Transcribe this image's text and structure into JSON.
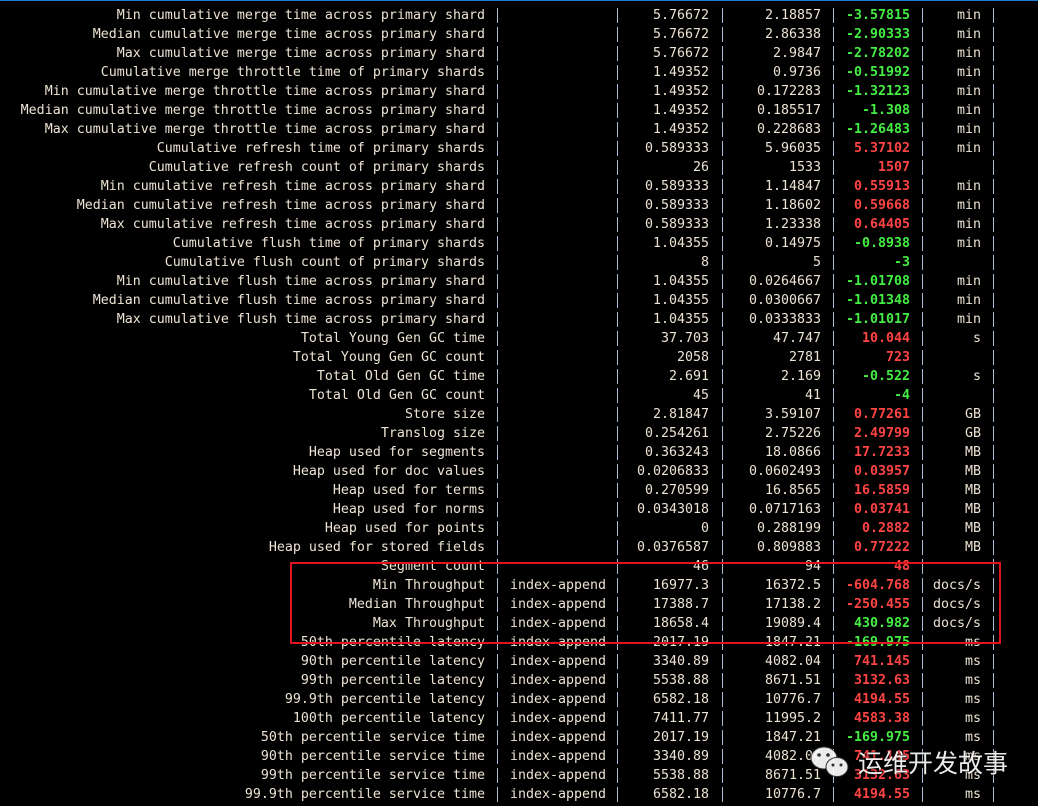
{
  "colors": {
    "positive_better": "#44ee44",
    "negative_worse": "#ff4444",
    "text": "#ede3d3",
    "pipe": "#a9bdd6",
    "highlight_box": "#e0141e"
  },
  "watermark": {
    "text": "运维开发故事",
    "icon": "wechat-icon"
  },
  "rows": [
    {
      "metric": "Min cumulative merge time across primary shard",
      "task": "",
      "baseline": "5.76672",
      "contender": "2.18857",
      "diff": "-3.57815",
      "unit": "min",
      "diff_color": "green"
    },
    {
      "metric": "Median cumulative merge time across primary shard",
      "task": "",
      "baseline": "5.76672",
      "contender": "2.86338",
      "diff": "-2.90333",
      "unit": "min",
      "diff_color": "green"
    },
    {
      "metric": "Max cumulative merge time across primary shard",
      "task": "",
      "baseline": "5.76672",
      "contender": "2.9847",
      "diff": "-2.78202",
      "unit": "min",
      "diff_color": "green"
    },
    {
      "metric": "Cumulative merge throttle time of primary shards",
      "task": "",
      "baseline": "1.49352",
      "contender": "0.9736",
      "diff": "-0.51992",
      "unit": "min",
      "diff_color": "green"
    },
    {
      "metric": "Min cumulative merge throttle time across primary shard",
      "task": "",
      "baseline": "1.49352",
      "contender": "0.172283",
      "diff": "-1.32123",
      "unit": "min",
      "diff_color": "green"
    },
    {
      "metric": "Median cumulative merge throttle time across primary shard",
      "task": "",
      "baseline": "1.49352",
      "contender": "0.185517",
      "diff": "-1.308",
      "unit": "min",
      "diff_color": "green"
    },
    {
      "metric": "Max cumulative merge throttle time across primary shard",
      "task": "",
      "baseline": "1.49352",
      "contender": "0.228683",
      "diff": "-1.26483",
      "unit": "min",
      "diff_color": "green"
    },
    {
      "metric": "Cumulative refresh time of primary shards",
      "task": "",
      "baseline": "0.589333",
      "contender": "5.96035",
      "diff": "5.37102",
      "unit": "min",
      "diff_color": "red"
    },
    {
      "metric": "Cumulative refresh count of primary shards",
      "task": "",
      "baseline": "26",
      "contender": "1533",
      "diff": "1507",
      "unit": "",
      "diff_color": "red"
    },
    {
      "metric": "Min cumulative refresh time across primary shard",
      "task": "",
      "baseline": "0.589333",
      "contender": "1.14847",
      "diff": "0.55913",
      "unit": "min",
      "diff_color": "red"
    },
    {
      "metric": "Median cumulative refresh time across primary shard",
      "task": "",
      "baseline": "0.589333",
      "contender": "1.18602",
      "diff": "0.59668",
      "unit": "min",
      "diff_color": "red"
    },
    {
      "metric": "Max cumulative refresh time across primary shard",
      "task": "",
      "baseline": "0.589333",
      "contender": "1.23338",
      "diff": "0.64405",
      "unit": "min",
      "diff_color": "red"
    },
    {
      "metric": "Cumulative flush time of primary shards",
      "task": "",
      "baseline": "1.04355",
      "contender": "0.14975",
      "diff": "-0.8938",
      "unit": "min",
      "diff_color": "green"
    },
    {
      "metric": "Cumulative flush count of primary shards",
      "task": "",
      "baseline": "8",
      "contender": "5",
      "diff": "-3",
      "unit": "",
      "diff_color": "green"
    },
    {
      "metric": "Min cumulative flush time across primary shard",
      "task": "",
      "baseline": "1.04355",
      "contender": "0.0264667",
      "diff": "-1.01708",
      "unit": "min",
      "diff_color": "green"
    },
    {
      "metric": "Median cumulative flush time across primary shard",
      "task": "",
      "baseline": "1.04355",
      "contender": "0.0300667",
      "diff": "-1.01348",
      "unit": "min",
      "diff_color": "green"
    },
    {
      "metric": "Max cumulative flush time across primary shard",
      "task": "",
      "baseline": "1.04355",
      "contender": "0.0333833",
      "diff": "-1.01017",
      "unit": "min",
      "diff_color": "green"
    },
    {
      "metric": "Total Young Gen GC time",
      "task": "",
      "baseline": "37.703",
      "contender": "47.747",
      "diff": "10.044",
      "unit": "s",
      "diff_color": "red"
    },
    {
      "metric": "Total Young Gen GC count",
      "task": "",
      "baseline": "2058",
      "contender": "2781",
      "diff": "723",
      "unit": "",
      "diff_color": "red"
    },
    {
      "metric": "Total Old Gen GC time",
      "task": "",
      "baseline": "2.691",
      "contender": "2.169",
      "diff": "-0.522",
      "unit": "s",
      "diff_color": "green"
    },
    {
      "metric": "Total Old Gen GC count",
      "task": "",
      "baseline": "45",
      "contender": "41",
      "diff": "-4",
      "unit": "",
      "diff_color": "green"
    },
    {
      "metric": "Store size",
      "task": "",
      "baseline": "2.81847",
      "contender": "3.59107",
      "diff": "0.77261",
      "unit": "GB",
      "diff_color": "red"
    },
    {
      "metric": "Translog size",
      "task": "",
      "baseline": "0.254261",
      "contender": "2.75226",
      "diff": "2.49799",
      "unit": "GB",
      "diff_color": "red"
    },
    {
      "metric": "Heap used for segments",
      "task": "",
      "baseline": "0.363243",
      "contender": "18.0866",
      "diff": "17.7233",
      "unit": "MB",
      "diff_color": "red"
    },
    {
      "metric": "Heap used for doc values",
      "task": "",
      "baseline": "0.0206833",
      "contender": "0.0602493",
      "diff": "0.03957",
      "unit": "MB",
      "diff_color": "red"
    },
    {
      "metric": "Heap used for terms",
      "task": "",
      "baseline": "0.270599",
      "contender": "16.8565",
      "diff": "16.5859",
      "unit": "MB",
      "diff_color": "red"
    },
    {
      "metric": "Heap used for norms",
      "task": "",
      "baseline": "0.0343018",
      "contender": "0.0717163",
      "diff": "0.03741",
      "unit": "MB",
      "diff_color": "red"
    },
    {
      "metric": "Heap used for points",
      "task": "",
      "baseline": "0",
      "contender": "0.288199",
      "diff": "0.2882",
      "unit": "MB",
      "diff_color": "red"
    },
    {
      "metric": "Heap used for stored fields",
      "task": "",
      "baseline": "0.0376587",
      "contender": "0.809883",
      "diff": "0.77222",
      "unit": "MB",
      "diff_color": "red"
    },
    {
      "metric": "Segment count",
      "task": "",
      "baseline": "46",
      "contender": "94",
      "diff": "48",
      "unit": "",
      "diff_color": "red"
    },
    {
      "metric": "Min Throughput",
      "task": "index-append",
      "baseline": "16977.3",
      "contender": "16372.5",
      "diff": "-604.768",
      "unit": "docs/s",
      "diff_color": "red"
    },
    {
      "metric": "Median Throughput",
      "task": "index-append",
      "baseline": "17388.7",
      "contender": "17138.2",
      "diff": "-250.455",
      "unit": "docs/s",
      "diff_color": "red"
    },
    {
      "metric": "Max Throughput",
      "task": "index-append",
      "baseline": "18658.4",
      "contender": "19089.4",
      "diff": "430.982",
      "unit": "docs/s",
      "diff_color": "green"
    },
    {
      "metric": "50th percentile latency",
      "task": "index-append",
      "baseline": "2017.19",
      "contender": "1847.21",
      "diff": "-169.975",
      "unit": "ms",
      "diff_color": "green"
    },
    {
      "metric": "90th percentile latency",
      "task": "index-append",
      "baseline": "3340.89",
      "contender": "4082.04",
      "diff": "741.145",
      "unit": "ms",
      "diff_color": "red"
    },
    {
      "metric": "99th percentile latency",
      "task": "index-append",
      "baseline": "5538.88",
      "contender": "8671.51",
      "diff": "3132.63",
      "unit": "ms",
      "diff_color": "red"
    },
    {
      "metric": "99.9th percentile latency",
      "task": "index-append",
      "baseline": "6582.18",
      "contender": "10776.7",
      "diff": "4194.55",
      "unit": "ms",
      "diff_color": "red"
    },
    {
      "metric": "100th percentile latency",
      "task": "index-append",
      "baseline": "7411.77",
      "contender": "11995.2",
      "diff": "4583.38",
      "unit": "ms",
      "diff_color": "red"
    },
    {
      "metric": "50th percentile service time",
      "task": "index-append",
      "baseline": "2017.19",
      "contender": "1847.21",
      "diff": "-169.975",
      "unit": "ms",
      "diff_color": "green"
    },
    {
      "metric": "90th percentile service time",
      "task": "index-append",
      "baseline": "3340.89",
      "contender": "4082.04",
      "diff": "741.145",
      "unit": "ms",
      "diff_color": "red"
    },
    {
      "metric": "99th percentile service time",
      "task": "index-append",
      "baseline": "5538.88",
      "contender": "8671.51",
      "diff": "3132.63",
      "unit": "ms",
      "diff_color": "red"
    },
    {
      "metric": "99.9th percentile service time",
      "task": "index-append",
      "baseline": "6582.18",
      "contender": "10776.7",
      "diff": "4194.55",
      "unit": "ms",
      "diff_color": "red"
    }
  ]
}
